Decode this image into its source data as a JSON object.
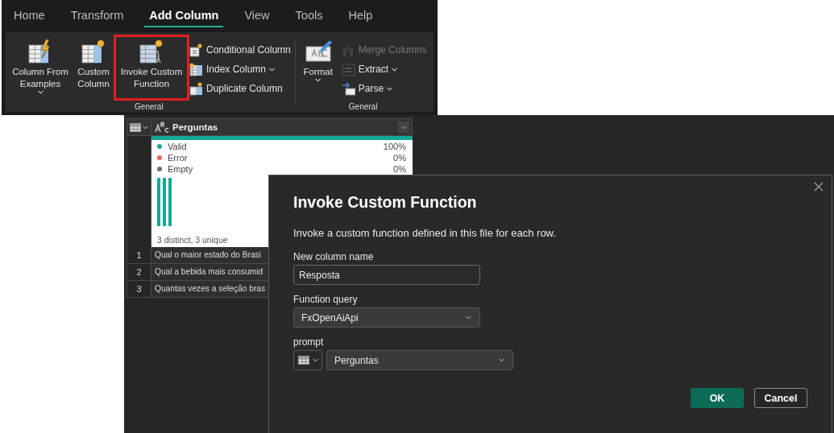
{
  "ribbon": {
    "tabs": [
      {
        "label": "Home",
        "selected": false
      },
      {
        "label": "Transform",
        "selected": false
      },
      {
        "label": "Add Column",
        "selected": true
      },
      {
        "label": "View",
        "selected": false
      },
      {
        "label": "Tools",
        "selected": false
      },
      {
        "label": "Help",
        "selected": false
      }
    ],
    "groups": [
      {
        "label": "General",
        "large_buttons": [
          {
            "label": "Column From Examples",
            "has_menu": true,
            "highlighted": false
          },
          {
            "label": "Custom Column",
            "has_menu": false,
            "highlighted": false
          },
          {
            "label": "Invoke Custom Function",
            "has_menu": false,
            "highlighted": true
          }
        ],
        "small_buttons": [
          {
            "label": "Conditional Column",
            "has_menu": false,
            "disabled": false
          },
          {
            "label": "Index Column",
            "has_menu": true,
            "disabled": false
          },
          {
            "label": "Duplicate Column",
            "has_menu": false,
            "disabled": false
          }
        ]
      },
      {
        "label": "General",
        "large_buttons": [
          {
            "label": "Format",
            "has_menu": true,
            "highlighted": false
          }
        ],
        "small_buttons": [
          {
            "label": "Merge Columns",
            "has_menu": false,
            "disabled": true
          },
          {
            "label": "Extract",
            "has_menu": true,
            "disabled": false
          },
          {
            "label": "Parse",
            "has_menu": true,
            "disabled": false
          }
        ]
      }
    ]
  },
  "grid": {
    "column_header": "Perguntas",
    "profile": {
      "legend": [
        {
          "label": "Valid",
          "value": "100%",
          "color": "#1aa89a"
        },
        {
          "label": "Error",
          "value": "0%",
          "color": "#f0625d"
        },
        {
          "label": "Empty",
          "value": "0%",
          "color": "#707070"
        }
      ],
      "summary": "3 distinct, 3 unique"
    },
    "rows": [
      {
        "number": "1",
        "text": "Qual o maior estado do Brasi"
      },
      {
        "number": "2",
        "text": "Qual a bebida mais consumid"
      },
      {
        "number": "3",
        "text": "Quantas vezes a seleção bras"
      }
    ]
  },
  "dialog": {
    "title": "Invoke Custom Function",
    "description": "Invoke a custom function defined in this file for each row.",
    "fields": [
      {
        "kind": "text",
        "label": "New column name",
        "value": "Resposta"
      },
      {
        "kind": "select",
        "label": "Function query",
        "value": "FxOpenAiApi"
      },
      {
        "kind": "column-select",
        "label": "prompt",
        "value": "Perguntas"
      }
    ],
    "buttons": [
      {
        "label": "OK",
        "primary": true
      },
      {
        "label": "Cancel",
        "primary": false
      }
    ]
  }
}
